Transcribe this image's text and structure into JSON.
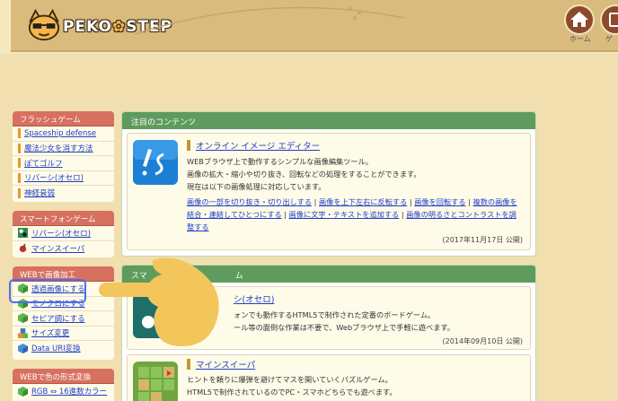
{
  "header": {
    "logo_text": "PEKO",
    "logo_text2": "STEP",
    "nav": [
      {
        "label": "ホーム",
        "icon": "home-icon"
      },
      {
        "label": "ゲ",
        "icon": "game-icon"
      }
    ]
  },
  "sidebar": {
    "flash": {
      "title": "フラッシュゲーム",
      "items": [
        "Spaceship defense",
        "魔法少女を消す方法",
        "ぽてゴルフ",
        "リバーシ(オセロ)",
        "神経衰弱"
      ]
    },
    "smartphone": {
      "title": "スマートフォンゲーム",
      "items": [
        "リバーシ(オセロ)",
        "マインスイーパ"
      ]
    },
    "web_image": {
      "title": "WEBで画像加工",
      "items": [
        "透過画像にする",
        "モノクロにする",
        "セピア調にする",
        "サイズ変更",
        "Data URI変換"
      ]
    },
    "color": {
      "title": "WEBで色の形式変換",
      "items": [
        "RGB ⇔ 16進数カラー"
      ]
    }
  },
  "featured": {
    "heading": "注目のコンテンツ",
    "title": "オンライン イメージ エディター",
    "desc": [
      "WEBブラウザ上で動作するシンプルな画像編集ツール。",
      "画像の拡大・縮小や切り抜き、回転などの処理をすることができます。",
      "現在は以下の画像処理に対応しています。"
    ],
    "links_line1": [
      "画像の一部を切り抜き・切り出しする",
      "画像を上下左右に反転する",
      "画像を回転する",
      "複数の画像を"
    ],
    "links_line2": [
      "結合・連結してひとつにする",
      "画像に文字・テキストを追加する",
      "画像の明るさとコントラストを調"
    ],
    "links_line3": "整する",
    "date": "(2017年11月17日 公開)"
  },
  "smartphone_games": {
    "heading": "スマ",
    "heading_tail": "ム",
    "game1": {
      "title_tail": "シ(オセロ)",
      "desc": [
        "ォンでも動作するHTML5で制作された定番のボードゲーム。",
        "ール等の面倒な作業は不要で、Webブラウザ上で手軽に遊べます。"
      ],
      "date": "(2014年09月10日 公開)"
    },
    "game2": {
      "title": "マインスイーパ",
      "desc": [
        "ヒントを頼りに爆弾を避けてマスを開いていくパズルゲーム。",
        "HTML5で制作されているのでPC・スマホどちらでも遊べます。"
      ]
    }
  },
  "colors": {
    "accent_red": "#d7705f",
    "accent_green": "#5e9b5d",
    "link_blue": "#1f3fc8",
    "highlight_blue": "#4d6cf0",
    "hand_yellow": "#f2c65a"
  }
}
